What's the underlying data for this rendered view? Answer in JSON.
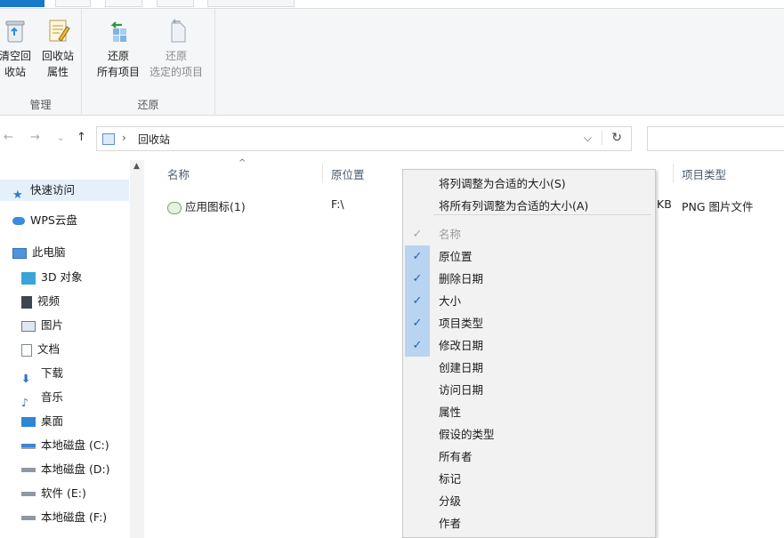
{
  "ribbon": {
    "groups": [
      {
        "label": "管理",
        "buttons": [
          {
            "label_l1": "清空回",
            "label_l2": "收站"
          },
          {
            "label_l1": "回收站",
            "label_l2": "属性"
          }
        ]
      },
      {
        "label": "还原",
        "buttons": [
          {
            "label_l1": "还原",
            "label_l2": "所有项目"
          },
          {
            "label_l1": "还原",
            "label_l2": "选定的项目"
          }
        ]
      }
    ]
  },
  "address": {
    "breadcrumb": "回收站",
    "separator": "›",
    "dropdown": "⌵",
    "refresh": "↻",
    "back": "←",
    "forward": "→",
    "recent": "⌄",
    "up": "↑"
  },
  "navpane": {
    "items": [
      {
        "label": "快速访问"
      },
      {
        "label": "WPS云盘"
      },
      {
        "label": "此电脑"
      },
      {
        "label": "3D 对象"
      },
      {
        "label": "视频"
      },
      {
        "label": "图片"
      },
      {
        "label": "文档"
      },
      {
        "label": "下载"
      },
      {
        "label": "音乐"
      },
      {
        "label": "桌面"
      },
      {
        "label": "本地磁盘 (C:)"
      },
      {
        "label": "本地磁盘 (D:)"
      },
      {
        "label": "软件 (E:)"
      },
      {
        "label": "本地磁盘 (F:)"
      }
    ]
  },
  "columns": {
    "name": "名称",
    "original_location": "原位置",
    "item_type": "项目类型"
  },
  "file": {
    "name": "应用图标(1)",
    "location": "F:\\",
    "size_suffix": "KB",
    "type": "PNG 图片文件"
  },
  "context_menu": {
    "top_items": [
      {
        "label": "将列调整为合适的大小(S)"
      },
      {
        "label": "将所有列调整为合适的大小(A)"
      }
    ],
    "columns": [
      {
        "label": "名称",
        "checked": true,
        "disabled": true
      },
      {
        "label": "原位置",
        "checked": true
      },
      {
        "label": "删除日期",
        "checked": true
      },
      {
        "label": "大小",
        "checked": true
      },
      {
        "label": "项目类型",
        "checked": true
      },
      {
        "label": "修改日期",
        "checked": true
      },
      {
        "label": "创建日期",
        "checked": false
      },
      {
        "label": "访问日期",
        "checked": false
      },
      {
        "label": "属性",
        "checked": false
      },
      {
        "label": "假设的类型",
        "checked": false
      },
      {
        "label": "所有者",
        "checked": false
      },
      {
        "label": "标记",
        "checked": false
      },
      {
        "label": "分级",
        "checked": false
      },
      {
        "label": "作者",
        "checked": false
      }
    ],
    "check_glyph": "✓"
  },
  "colors": {
    "accent": "#1979ca",
    "check_highlight": "#b9d4f0",
    "nav_selected": "#e5f0fb"
  }
}
